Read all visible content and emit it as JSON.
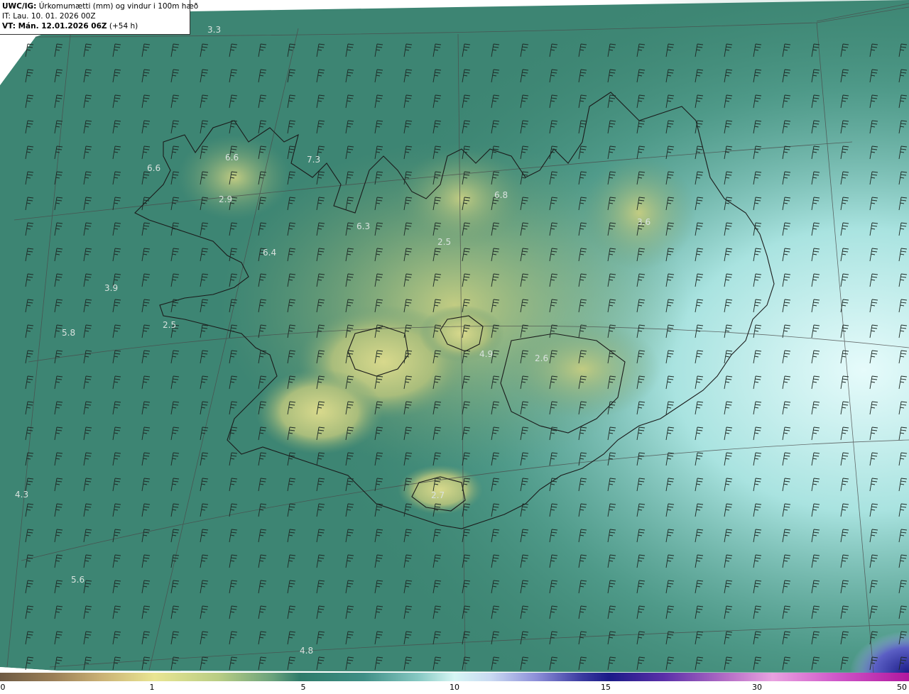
{
  "header": {
    "model": "UWC/IG:",
    "title": "Úrkomumætti (mm) og vindur i 100m hæð",
    "initial_time": "IT: Lau. 10. 01. 2026 00Z",
    "valid_time_label": "VT: Mán. 12.01.2026 06Z",
    "lead_time": "(+54 h)"
  },
  "map_labels": [
    "3.3",
    "6.6",
    "7.3",
    "6.6",
    "2.9",
    "6.8",
    "3.6",
    "6.3",
    "2.5",
    "6.4",
    "3.9",
    "5.8",
    "2.5",
    "4.9",
    "2.6",
    "4.3",
    "2.7",
    "5.6",
    "4.8"
  ],
  "colorbar": {
    "ticks": [
      "0",
      "1",
      "5",
      "10",
      "15",
      "30",
      "50"
    ]
  },
  "colors": {
    "low": "#c9c97a",
    "mid": "#3f8a74",
    "high": "#d6f6f4",
    "extreme": "#2a1f8c"
  }
}
